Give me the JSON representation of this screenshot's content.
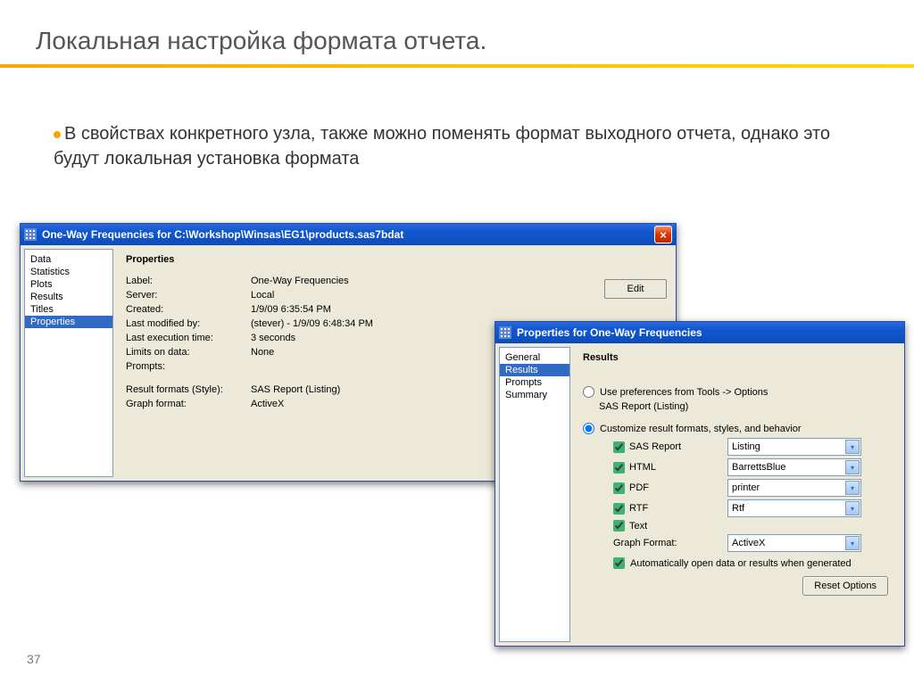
{
  "slide": {
    "title": "Локальная настройка формата отчета.",
    "bullet": "В свойствах конкретного узла, также можно поменять формат выходного отчета, однако это будут локальная установка формата",
    "page": "37"
  },
  "win1": {
    "title": "One-Way Frequencies for C:\\Workshop\\Winsas\\EG1\\products.sas7bdat",
    "editBtn": "Edit",
    "sidebar": [
      "Data",
      "Statistics",
      "Plots",
      "Results",
      "Titles",
      "Properties"
    ],
    "selectedIndex": 5,
    "heading": "Properties",
    "rows": {
      "label_l": "Label:",
      "label_v": "One-Way Frequencies",
      "server_l": "Server:",
      "server_v": "Local",
      "created_l": "Created:",
      "created_v": "1/9/09 6:35:54 PM",
      "mod_l": "Last modified by:",
      "mod_v": " (stever) - 1/9/09 6:48:34 PM",
      "exec_l": "Last execution time:",
      "exec_v": "3 seconds",
      "limits_l": "Limits on data:",
      "limits_v": "None",
      "prompts_l": "Prompts:",
      "prompts_v": "",
      "result_l": "Result formats (Style):",
      "result_v": "SAS Report (Listing)",
      "graph_l": "Graph format:",
      "graph_v": "ActiveX"
    }
  },
  "win2": {
    "title": "Properties for One-Way Frequencies",
    "sidebar": [
      "General",
      "Results",
      "Prompts",
      "Summary"
    ],
    "selectedIndex": 1,
    "heading": "Results",
    "radio1": "Use preferences from Tools -> Options",
    "radio1sub": "SAS Report (Listing)",
    "radio2": "Customize result formats, styles, and behavior",
    "formats": {
      "sas_l": "SAS Report",
      "sas_v": "Listing",
      "html_l": "HTML",
      "html_v": "BarrettsBlue",
      "pdf_l": "PDF",
      "pdf_v": "printer",
      "rtf_l": "RTF",
      "rtf_v": "Rtf",
      "text_l": "Text",
      "graph_l": "Graph Format:",
      "graph_v": "ActiveX"
    },
    "autoOpen": "Automatically open data or results when generated",
    "resetBtn": "Reset Options"
  }
}
